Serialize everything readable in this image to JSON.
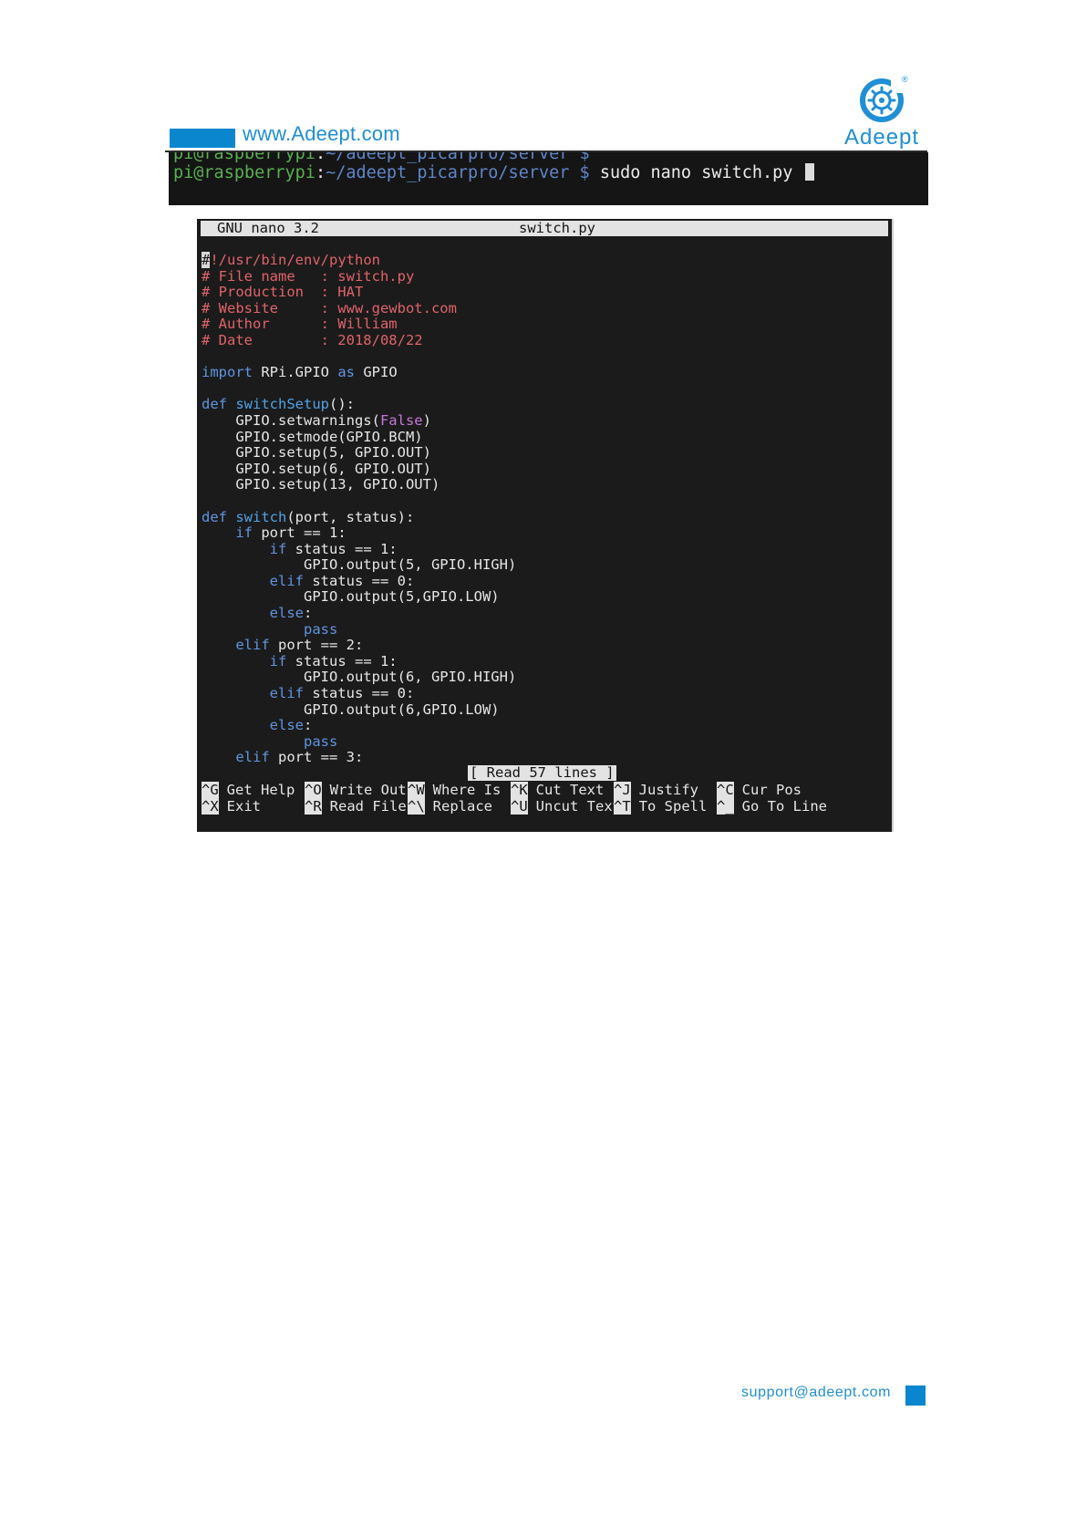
{
  "header": {
    "url": "www.Adeept.com",
    "logo_text": "Adeept",
    "logo_reg": "®"
  },
  "shell": {
    "prev_line": {
      "user": "pi@raspberrypi",
      "path": "~/adeept_picarpro/server",
      "prompt": "$"
    },
    "line": {
      "user": "pi@raspberrypi",
      "colon": ":",
      "path": "~/adeept_picarpro/server",
      "prompt": "$",
      "command": "sudo nano switch.py"
    }
  },
  "nano": {
    "version": "GNU nano 3.2",
    "filename": "switch.py",
    "status_message": "[ Read 57 lines ]",
    "code_lines": [
      [
        {
          "t": "#",
          "c": "shebang"
        },
        {
          "t": "!/usr/bin/env/python",
          "c": "comment"
        }
      ],
      [
        {
          "t": "# File name   : switch.py",
          "c": "comment"
        }
      ],
      [
        {
          "t": "# Production  : HAT",
          "c": "comment"
        }
      ],
      [
        {
          "t": "# Website     : www.gewbot.com",
          "c": "comment"
        }
      ],
      [
        {
          "t": "# Author      : William",
          "c": "comment"
        }
      ],
      [
        {
          "t": "# Date        : 2018/08/22",
          "c": "comment"
        }
      ],
      [],
      [
        {
          "t": "import",
          "c": "kw"
        },
        {
          "t": " RPi.GPIO ",
          "c": "plain"
        },
        {
          "t": "as",
          "c": "kw"
        },
        {
          "t": " GPIO",
          "c": "plain"
        }
      ],
      [],
      [
        {
          "t": "def",
          "c": "kw"
        },
        {
          "t": " ",
          "c": "plain"
        },
        {
          "t": "switchSetup",
          "c": "fn"
        },
        {
          "t": "():",
          "c": "plain"
        }
      ],
      [
        {
          "t": "    GPIO.setwarnings(",
          "c": "plain"
        },
        {
          "t": "False",
          "c": "const"
        },
        {
          "t": ")",
          "c": "plain"
        }
      ],
      [
        {
          "t": "    GPIO.setmode(GPIO.BCM)",
          "c": "plain"
        }
      ],
      [
        {
          "t": "    GPIO.setup(5, GPIO.OUT)",
          "c": "plain"
        }
      ],
      [
        {
          "t": "    GPIO.setup(6, GPIO.OUT)",
          "c": "plain"
        }
      ],
      [
        {
          "t": "    GPIO.setup(13, GPIO.OUT)",
          "c": "plain"
        }
      ],
      [],
      [
        {
          "t": "def",
          "c": "kw"
        },
        {
          "t": " ",
          "c": "plain"
        },
        {
          "t": "switch",
          "c": "fn"
        },
        {
          "t": "(port, status):",
          "c": "plain"
        }
      ],
      [
        {
          "t": "    ",
          "c": "plain"
        },
        {
          "t": "if",
          "c": "kw"
        },
        {
          "t": " port == 1:",
          "c": "plain"
        }
      ],
      [
        {
          "t": "        ",
          "c": "plain"
        },
        {
          "t": "if",
          "c": "kw"
        },
        {
          "t": " status == 1:",
          "c": "plain"
        }
      ],
      [
        {
          "t": "            GPIO.output(5, GPIO.HIGH)",
          "c": "plain"
        }
      ],
      [
        {
          "t": "        ",
          "c": "plain"
        },
        {
          "t": "elif",
          "c": "kw"
        },
        {
          "t": " status == 0:",
          "c": "plain"
        }
      ],
      [
        {
          "t": "            GPIO.output(5,GPIO.LOW)",
          "c": "plain"
        }
      ],
      [
        {
          "t": "        ",
          "c": "plain"
        },
        {
          "t": "else",
          "c": "kw"
        },
        {
          "t": ":",
          "c": "plain"
        }
      ],
      [
        {
          "t": "            ",
          "c": "plain"
        },
        {
          "t": "pass",
          "c": "kw"
        }
      ],
      [
        {
          "t": "    ",
          "c": "plain"
        },
        {
          "t": "elif",
          "c": "kw"
        },
        {
          "t": " port == 2:",
          "c": "plain"
        }
      ],
      [
        {
          "t": "        ",
          "c": "plain"
        },
        {
          "t": "if",
          "c": "kw"
        },
        {
          "t": " status == 1:",
          "c": "plain"
        }
      ],
      [
        {
          "t": "            GPIO.output(6, GPIO.HIGH)",
          "c": "plain"
        }
      ],
      [
        {
          "t": "        ",
          "c": "plain"
        },
        {
          "t": "elif",
          "c": "kw"
        },
        {
          "t": " status == 0:",
          "c": "plain"
        }
      ],
      [
        {
          "t": "            GPIO.output(6,GPIO.LOW)",
          "c": "plain"
        }
      ],
      [
        {
          "t": "        ",
          "c": "plain"
        },
        {
          "t": "else",
          "c": "kw"
        },
        {
          "t": ":",
          "c": "plain"
        }
      ],
      [
        {
          "t": "            ",
          "c": "plain"
        },
        {
          "t": "pass",
          "c": "kw"
        }
      ],
      [
        {
          "t": "    ",
          "c": "plain"
        },
        {
          "t": "elif",
          "c": "kw"
        },
        {
          "t": " port == 3:",
          "c": "plain"
        }
      ]
    ],
    "shortcuts": [
      [
        {
          "key": "^G",
          "label": "Get Help"
        },
        {
          "key": "^O",
          "label": "Write Out"
        },
        {
          "key": "^W",
          "label": "Where Is"
        },
        {
          "key": "^K",
          "label": "Cut Text"
        },
        {
          "key": "^J",
          "label": "Justify"
        },
        {
          "key": "^C",
          "label": "Cur Pos"
        }
      ],
      [
        {
          "key": "^X",
          "label": "Exit"
        },
        {
          "key": "^R",
          "label": "Read File"
        },
        {
          "key": "^\\",
          "label": "Replace"
        },
        {
          "key": "^U",
          "label": "Uncut Text"
        },
        {
          "key": "^T",
          "label": "To Spell"
        },
        {
          "key": "^_",
          "label": "Go To Line"
        }
      ]
    ]
  },
  "footer": {
    "email": "support@adeept.com"
  },
  "colors": {
    "brand_blue": "#0a86cf",
    "terminal_bg": "#1b1b1b",
    "comment": "#e0646a",
    "keyword": "#5f96e0"
  }
}
